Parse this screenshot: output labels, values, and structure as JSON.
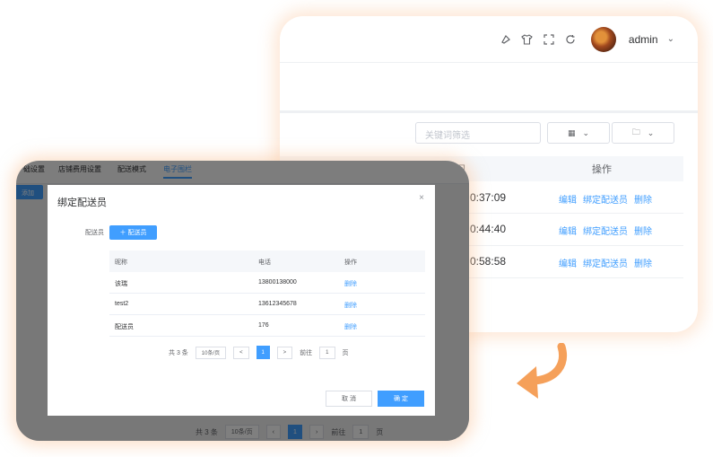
{
  "back_panel": {
    "header": {
      "icons": [
        "brush-icon",
        "shirt-icon",
        "fullscreen-icon",
        "refresh-icon"
      ],
      "username": "admin"
    },
    "search_placeholder": "关键词筛选",
    "table": {
      "time_header": "间",
      "op_header": "操作",
      "rows": [
        {
          "time": "0:37:09",
          "actions": [
            "编辑",
            "绑定配送员",
            "删除"
          ]
        },
        {
          "time": "0:44:40",
          "actions": [
            "编辑",
            "绑定配送员",
            "删除"
          ]
        },
        {
          "time": "0:58:58",
          "actions": [
            "编辑",
            "绑定配送员",
            "删除"
          ]
        }
      ]
    }
  },
  "front_panel": {
    "tabs": [
      "础设置",
      "店铺费用设置",
      "配送模式",
      "电子围栏"
    ],
    "active_tab": "电子围栏",
    "add_button": "添加",
    "background_pager": {
      "total": "共 3 条",
      "page_size": "10条/页",
      "current": "1",
      "goto_label": "前往",
      "goto_value": "1",
      "page_suffix": "页"
    },
    "dialog": {
      "title": "绑定配送员",
      "close": "×",
      "field_label": "配送员",
      "add_button": "＋ 配送员",
      "columns": [
        "昵称",
        "电话",
        "操作"
      ],
      "rows": [
        {
          "nickname": "该瑞",
          "phone": "13800138000",
          "action": "删除"
        },
        {
          "nickname": "test2",
          "phone": "13612345678",
          "action": "删除"
        },
        {
          "nickname": "配送员",
          "phone": "176",
          "action": "删除"
        }
      ],
      "pager": {
        "total": "共 3 条",
        "page_size": "10条/页",
        "prev": "<",
        "current": "1",
        "next": ">",
        "goto_label": "前往",
        "goto_value": "1",
        "page_suffix": "页"
      },
      "cancel": "取 消",
      "confirm": "确 定"
    }
  },
  "colors": {
    "primary": "#409eff",
    "glow": "#fac8a0",
    "arrow": "#f5a05a"
  }
}
